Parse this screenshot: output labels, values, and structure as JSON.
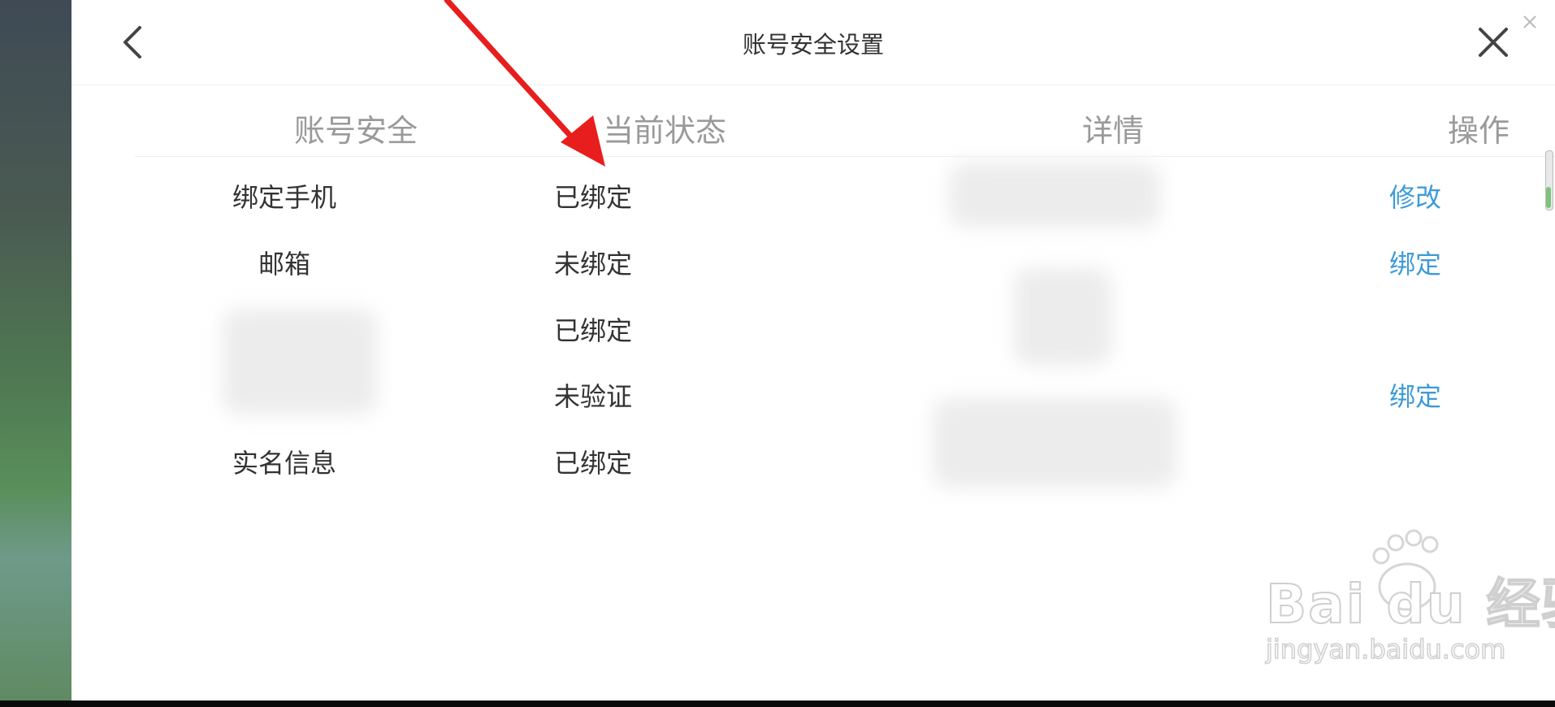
{
  "window": {
    "title": "账号安全设置"
  },
  "table": {
    "headers": [
      "账号安全",
      "当前状态",
      "详情",
      "操作"
    ],
    "rows": [
      {
        "name": "绑定手机",
        "status": "已绑定",
        "action": "修改"
      },
      {
        "name": "邮箱",
        "status": "未绑定",
        "action": "绑定"
      },
      {
        "name": "",
        "status": "已绑定",
        "action": ""
      },
      {
        "name": "",
        "status": "未验证",
        "action": "绑定"
      },
      {
        "name": "实名信息",
        "status": "已绑定",
        "action": ""
      }
    ]
  },
  "watermark": {
    "brand": "Bai du 经验",
    "url": "jingyan.baidu.com"
  },
  "icons": {
    "back": "chevron-left-icon",
    "close": "close-icon",
    "annotation": "red-arrow-icon"
  },
  "colors": {
    "accent": "#3e9bd6",
    "header_text": "#9a9a9a",
    "body_text": "#333333",
    "arrow": "#e81d1d"
  }
}
